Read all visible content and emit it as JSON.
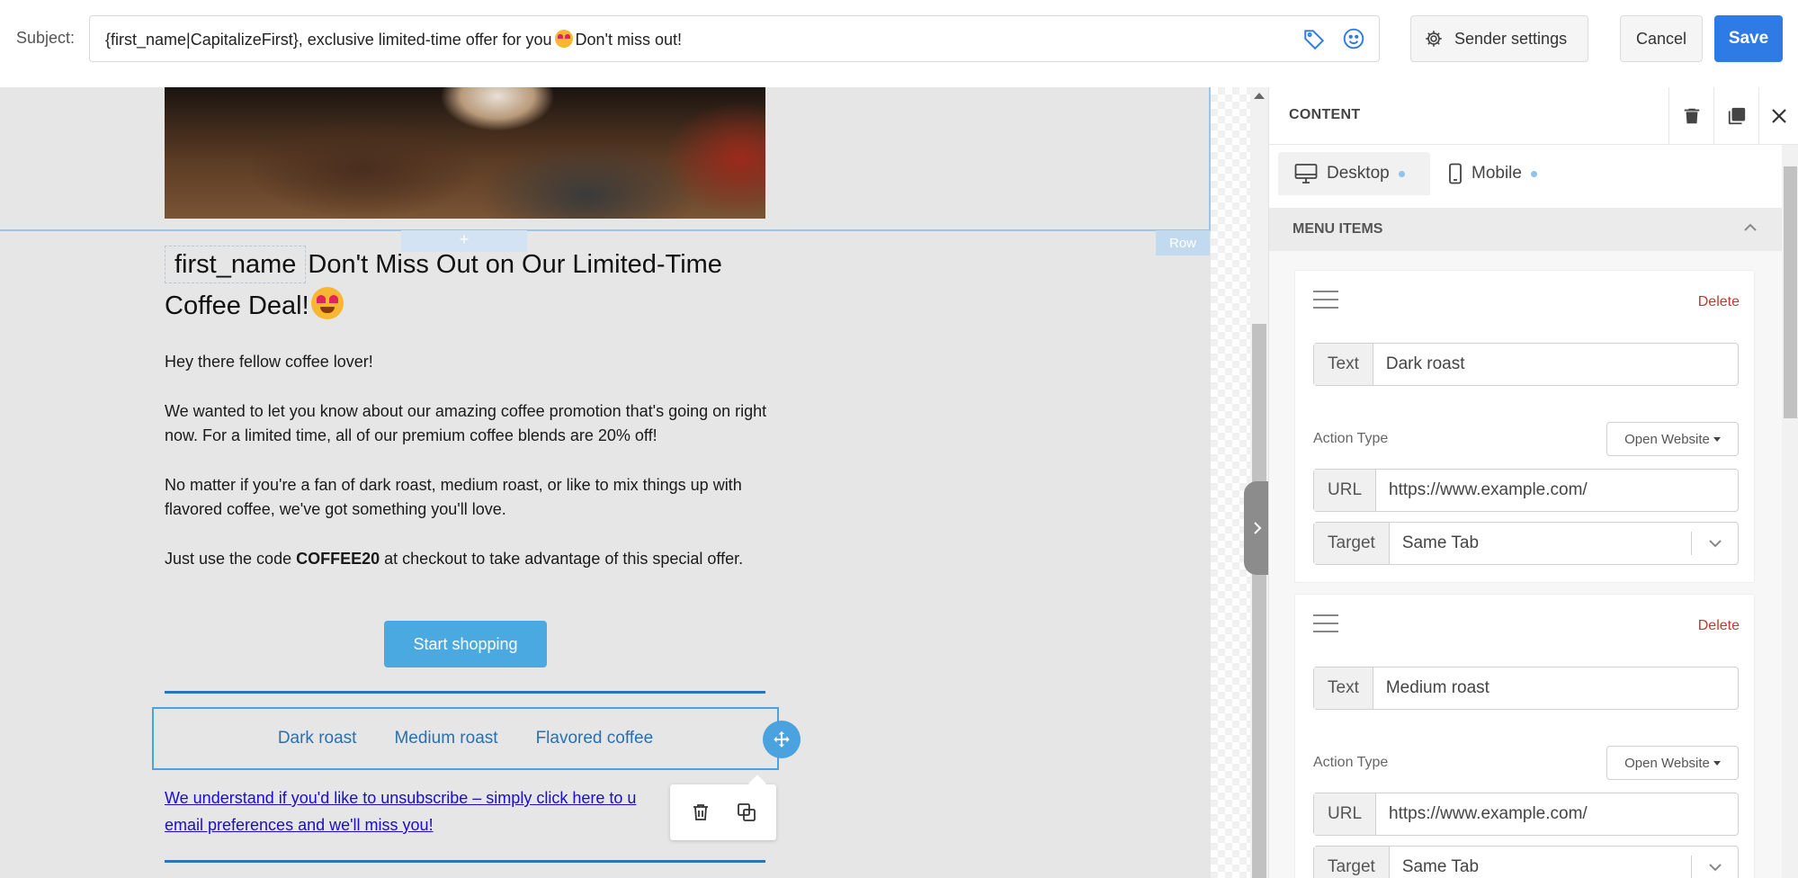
{
  "subject": {
    "label": "Subject:",
    "value_before_emoji": "{first_name|CapitalizeFirst}, exclusive limited-time offer for you",
    "value_after_emoji": "Don't miss out!"
  },
  "toolbar": {
    "sender_settings_label": "Sender settings",
    "cancel_label": "Cancel",
    "save_label": "Save",
    "save_color": "#2f7be6"
  },
  "email": {
    "row_label": "Row",
    "add_symbol": "+",
    "merge_tag": "first_name",
    "headline": "Don't Miss Out on Our Limited-Time Coffee Deal!",
    "greeting": "Hey there fellow coffee lover!",
    "paragraph_1": "We wanted to let you know about our amazing coffee promotion that's going on right now. For a limited time, all of our premium coffee blends are 20% off!",
    "paragraph_2": "No matter if you're a fan of dark roast, medium roast, or like to mix things up with flavored coffee, we've got something you'll love.",
    "paragraph_3_before": "Just use the code",
    "promo_code": "COFFEE20",
    "paragraph_3_after": "at checkout to take advantage of this special offer.",
    "cta_label": "Start shopping",
    "cta_color": "#4aa9e0",
    "menu_links": [
      "Dark roast",
      "Medium roast",
      "Flavored coffee"
    ],
    "unsubscribe_text": "We understand if you'd like to unsubscribe – simply click here to u",
    "unsubscribe_text_line2": "email preferences and we'll miss you!"
  },
  "panel": {
    "title": "CONTENT",
    "tabs": [
      {
        "label": "Desktop",
        "icon": "monitor-icon"
      },
      {
        "label": "Mobile",
        "icon": "phone-icon"
      }
    ],
    "section_title": "MENU ITEMS",
    "items": [
      {
        "delete_label": "Delete",
        "text_addon": "Text",
        "text_value": "Dark roast",
        "action_type_label": "Action Type",
        "action_type_value": "Open Website",
        "url_addon": "URL",
        "url_value": "https://www.example.com/",
        "target_addon": "Target",
        "target_value": "Same Tab"
      },
      {
        "delete_label": "Delete",
        "text_addon": "Text",
        "text_value": "Medium roast",
        "action_type_label": "Action Type",
        "action_type_value": "Open Website",
        "url_addon": "URL",
        "url_value": "https://www.example.com/",
        "target_addon": "Target",
        "target_value": "Same Tab"
      }
    ]
  }
}
